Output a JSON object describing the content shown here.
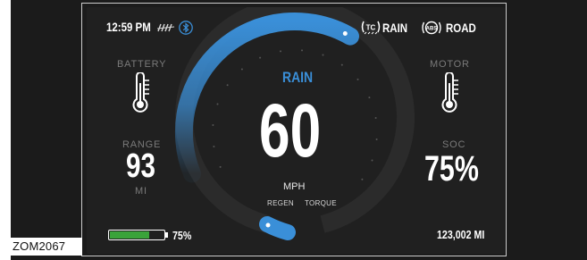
{
  "caption": "ZOM2067",
  "status_bar": {
    "time": "12:59 PM",
    "traction_icon_text": "TC",
    "traction_mode": "RAIN",
    "abs_icon_text": "ABS",
    "abs_mode": "ROAD"
  },
  "battery": {
    "label": "BATTERY"
  },
  "motor": {
    "label": "MOTOR"
  },
  "range": {
    "label": "RANGE",
    "value": "93",
    "unit": "MI"
  },
  "soc": {
    "label": "SOC",
    "value": "75%"
  },
  "speedometer": {
    "mode": "RAIN",
    "speed": "60",
    "unit": "MPH",
    "regen_label": "REGEN",
    "torque_label": "TORQUE",
    "speed_fraction": 0.5
  },
  "battery_bar": {
    "level": 0.75,
    "text": "75%"
  },
  "odometer": "123,002 MI",
  "colors": {
    "accent_blue": "#3a8fd8",
    "battery_green": "#3aa33a",
    "label_gray": "#7a7a7a",
    "background": "#202020"
  }
}
